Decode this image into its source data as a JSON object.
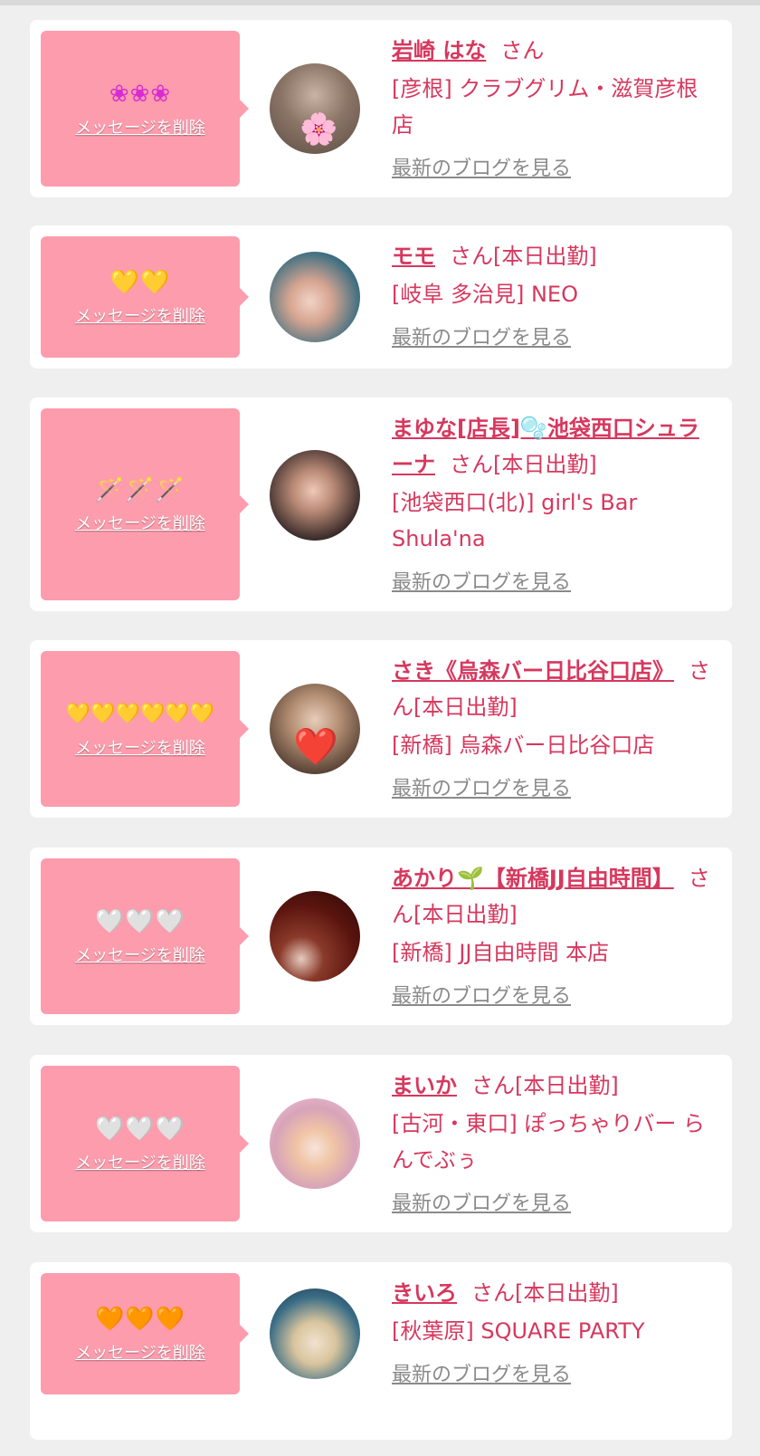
{
  "colors": {
    "accent": "#d6385e",
    "bubble": "#fc9cad",
    "muted_link": "#8a8a8a",
    "background": "#efefef"
  },
  "labels": {
    "delete": "メッセージを削除",
    "blog": "最新のブログを見る",
    "san": "さん"
  },
  "cards": [
    {
      "stamp": "❀❀❀",
      "stamp_color": "#d92bd4",
      "name": "岩崎 はな",
      "suffix": "さん",
      "shop": "[彦根] クラブグリム・滋賀彦根店",
      "avatar_emoji": "🌸",
      "avatar_bg": "#7a6a60"
    },
    {
      "stamp": "💛💛",
      "stamp_color": "#f5b800",
      "name": "モモ",
      "suffix": "さん[本日出勤]",
      "shop": "[岐阜 多治見] NEO",
      "avatar_emoji": "",
      "avatar_bg": "#4aa7a0"
    },
    {
      "stamp": "🪄🪄🪄",
      "stamp_color": "#c9a46c",
      "name": "まゆな[店長]🫧池袋西口シュラーナ",
      "suffix": "さん[本日出勤]",
      "shop": "[池袋西口(北)] girl's Bar Shula'na",
      "avatar_emoji": "",
      "avatar_bg": "#4a3a38"
    },
    {
      "stamp": "💛💛💛💛💛💛",
      "stamp_color": "#f5b800",
      "name": "さき《烏森バー日比谷口店》",
      "suffix": "さん[本日出勤]",
      "shop": "[新橋] 烏森バー日比谷口店",
      "avatar_emoji": "❤️",
      "avatar_bg": "#6b5446"
    },
    {
      "stamp": "🤍🤍🤍",
      "stamp_color": "#ffffff",
      "name": "あかり🌱【新橋JJ自由時間】",
      "suffix": "さん[本日出勤]",
      "shop": "[新橋] JJ自由時間 本店",
      "avatar_emoji": "",
      "avatar_bg": "#6a1a12"
    },
    {
      "stamp": "🤍🤍🤍",
      "stamp_color": "#ffffff",
      "name": "まいか",
      "suffix": "さん[本日出勤]",
      "shop": "[古河・東口] ぽっちゃりバー らんでぶぅ",
      "avatar_emoji": "",
      "avatar_bg": "#f3b9d6"
    },
    {
      "stamp": "🧡🧡🧡",
      "stamp_color": "#ff8a00",
      "name": "きいろ",
      "suffix": "さん[本日出勤]",
      "shop": "[秋葉原] SQUARE PARTY",
      "avatar_emoji": "",
      "avatar_bg": "#2a4f63"
    }
  ]
}
